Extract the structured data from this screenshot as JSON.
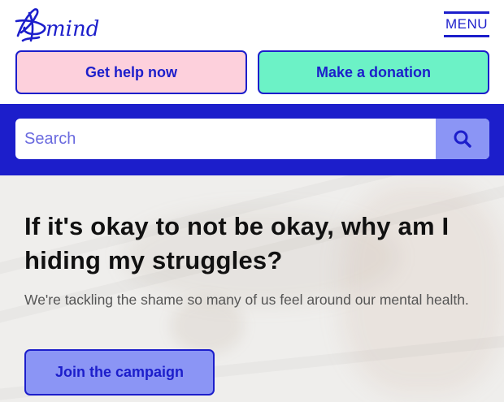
{
  "brand": {
    "name": "mind",
    "icon": "mind-logo-icon",
    "accent": "#1c1ecb"
  },
  "header": {
    "menu_label": "MENU"
  },
  "actions": {
    "help_label": "Get help now",
    "help_color": "#fdd0dc",
    "donate_label": "Make a donation",
    "donate_color": "#6cf2c6"
  },
  "search": {
    "placeholder": "Search",
    "value": "",
    "button_icon": "search-icon"
  },
  "hero": {
    "headline": "If it's okay to not be okay, why am I hiding my struggles?",
    "subtext": "We're tackling the shame so many of us feel around our mental health.",
    "cta_label": "Join the campaign",
    "cta_color": "#8b95f5"
  }
}
